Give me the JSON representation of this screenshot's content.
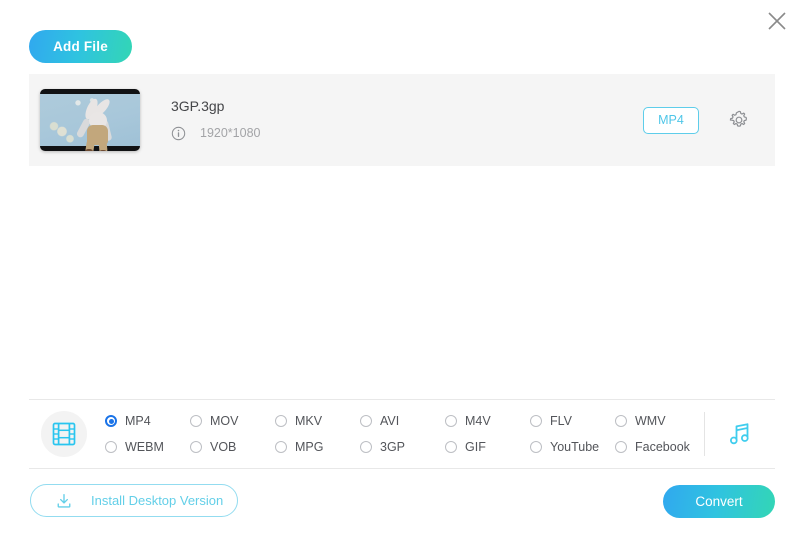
{
  "window": {
    "close_label": "×",
    "close_icon": "close-icon"
  },
  "toolbar": {
    "add_file_label": "Add File"
  },
  "file_list": {
    "items": [
      {
        "name": "3GP.3gp",
        "resolution": "1920*1080",
        "info_icon": "info-circle-icon",
        "target_format": "MP4",
        "settings_icon": "gear-icon",
        "thumbnail_alt": "stuffed bunny toy on blue background"
      }
    ]
  },
  "format_picker": {
    "media_icon": "film-strip-icon",
    "audio_icon": "music-note-icon",
    "selected": "MP4",
    "options": [
      "MP4",
      "MOV",
      "MKV",
      "AVI",
      "M4V",
      "FLV",
      "WMV",
      "WEBM",
      "VOB",
      "MPG",
      "3GP",
      "GIF",
      "YouTube",
      "Facebook"
    ]
  },
  "footer": {
    "install_label": "Install Desktop Version",
    "install_icon": "download-icon",
    "convert_label": "Convert"
  },
  "colors": {
    "accent_cyan": "#4fc6e8",
    "gradient_start": "#30a8ef",
    "gradient_end": "#33d6b5",
    "radio_selected": "#1a73e8",
    "row_background": "#f5f5f5"
  }
}
